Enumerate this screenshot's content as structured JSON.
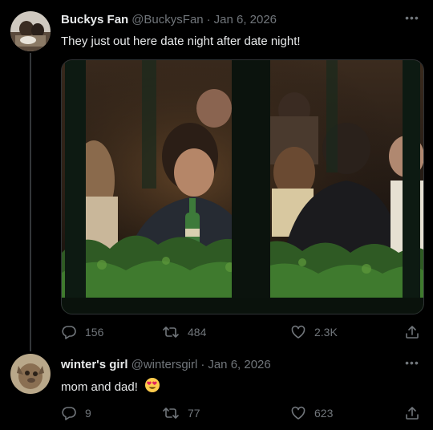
{
  "tweet": {
    "display_name": "Buckys Fan",
    "handle": "@BuckysFan",
    "separator": "·",
    "date": "Jan 6, 2026",
    "more_label": "•••",
    "text": "They just out here date night after date night!",
    "media_icon": "photo-restaurant-window",
    "stats": {
      "replies": "156",
      "retweets": "484",
      "likes": "2.3K"
    }
  },
  "reply": {
    "display_name": "winter's girl",
    "handle": "@wintersgirl",
    "separator": "·",
    "date": "Jan 6, 2026",
    "more_label": "•••",
    "text": "mom and dad!",
    "emoji": "heart-eyes-emoji",
    "stats": {
      "replies": "9",
      "retweets": "77",
      "likes": "623"
    }
  },
  "colors": {
    "background": "#000000",
    "primary_text": "#e7e9ea",
    "secondary_text": "#71767b",
    "divider": "#2f3336"
  }
}
